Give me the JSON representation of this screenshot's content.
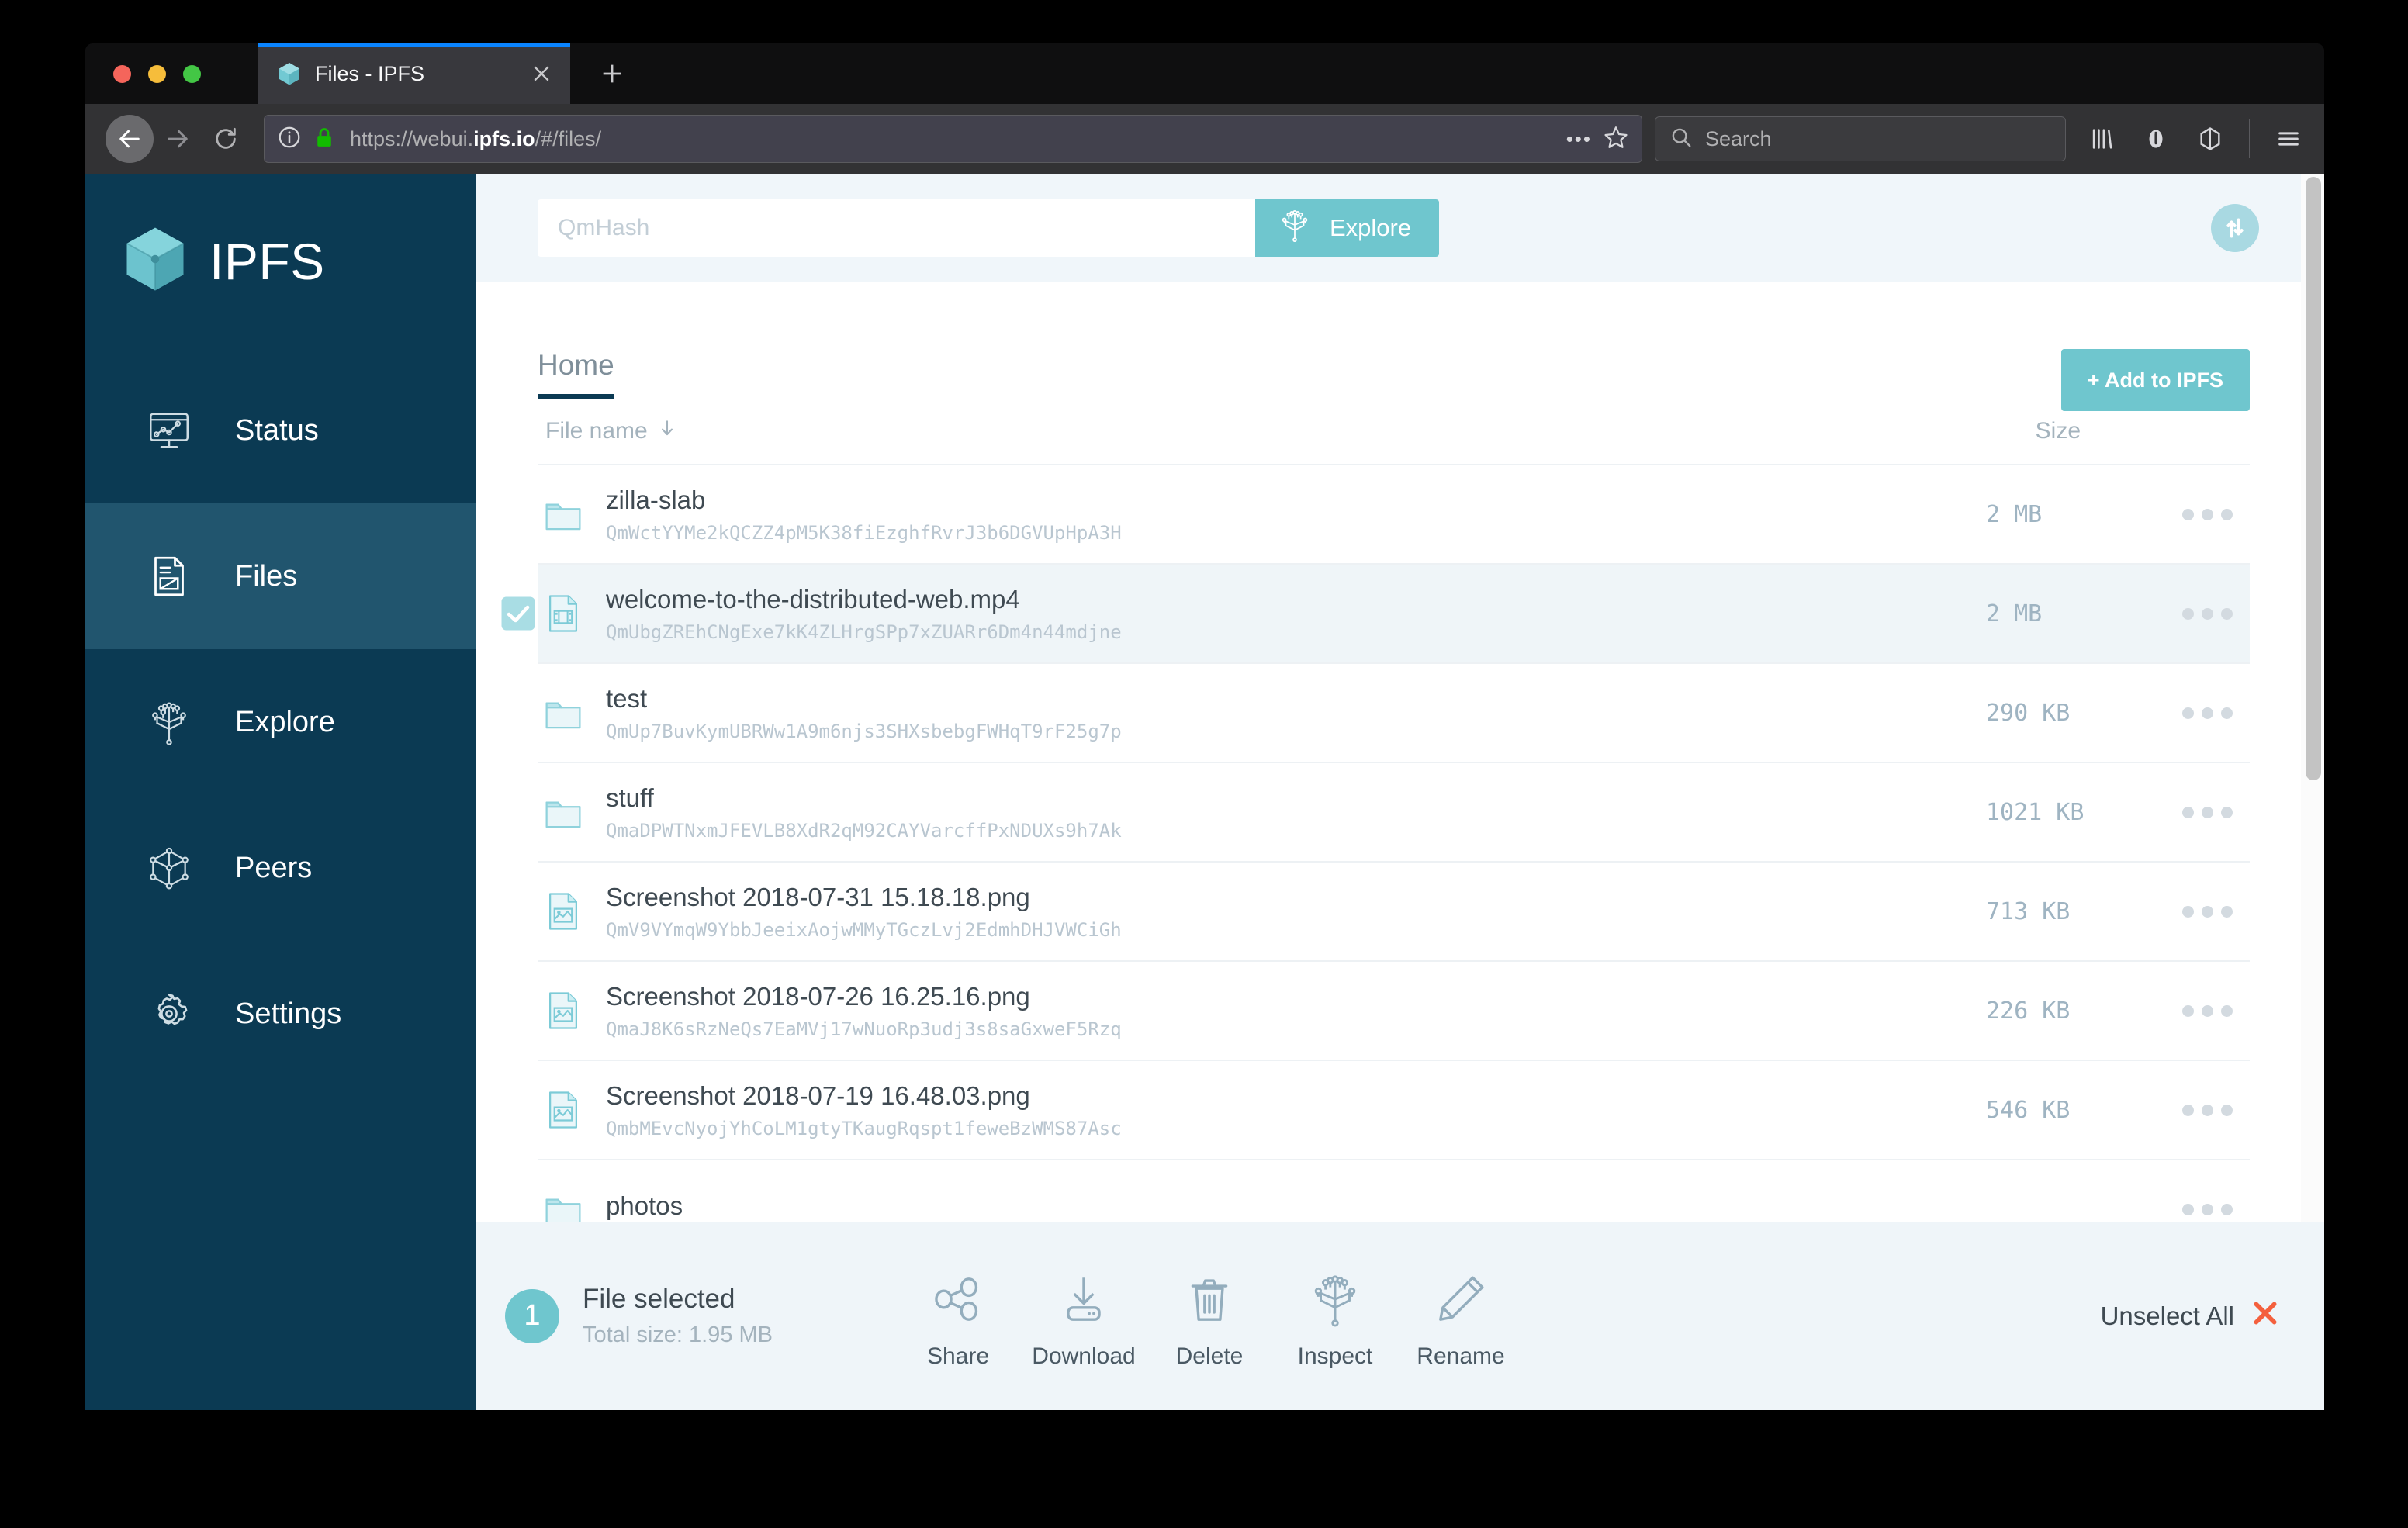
{
  "browser": {
    "tab": {
      "title": "Files - IPFS",
      "favicon_icon": "ipfs-cube-icon",
      "close_icon": "close-icon"
    },
    "new_tab_label": "+",
    "nav": {
      "back_icon": "back-arrow-icon",
      "forward_icon": "forward-arrow-icon",
      "reload_icon": "reload-icon"
    },
    "url": {
      "info_icon": "page-info-icon",
      "lock_icon": "lock-icon",
      "prefix": "https://webui.",
      "host": "ipfs.io",
      "path": "/#/files/",
      "more_icon": "more-actions-icon",
      "bookmark_icon": "star-icon"
    },
    "search": {
      "placeholder": "Search",
      "icon": "search-icon"
    },
    "toolbar_icons": [
      "library-icon",
      "sync-account-icon",
      "ipfs-companion-icon",
      "hamburger-menu-icon"
    ]
  },
  "sidebar": {
    "brand": "IPFS",
    "logo_icon": "ipfs-cube-logo-icon",
    "items": [
      {
        "label": "Status",
        "icon": "status-monitor-icon",
        "active": false
      },
      {
        "label": "Files",
        "icon": "file-document-icon",
        "active": true
      },
      {
        "label": "Explore",
        "icon": "explore-tree-icon",
        "active": false
      },
      {
        "label": "Peers",
        "icon": "peers-cube-icon",
        "active": false
      },
      {
        "label": "Settings",
        "icon": "settings-gear-icon",
        "active": false
      }
    ]
  },
  "app_header": {
    "hash_input_placeholder": "QmHash",
    "hash_input_value": "",
    "explore_button": "Explore",
    "explore_icon": "explore-tree-icon",
    "sync_icon": "sync-up-down-icon"
  },
  "files_page": {
    "tab_label": "Home",
    "add_button": "+ Add to IPFS",
    "columns": {
      "name": "File name",
      "name_sort_icon": "arrow-down-icon",
      "size": "Size"
    },
    "rows": [
      {
        "name": "zilla-slab",
        "hash": "QmWctYYMe2kQCZZ4pM5K38fiEzghfRvrJ3b6DGVUpHpA3H",
        "size": "2 MB",
        "type": "folder",
        "selected": false
      },
      {
        "name": "welcome-to-the-distributed-web.mp4",
        "hash": "QmUbgZREhCNgExe7kK4ZLHrgSPp7xZUARr6Dm4n44mdjne",
        "size": "2 MB",
        "type": "video",
        "selected": true
      },
      {
        "name": "test",
        "hash": "QmUp7BuvKymUBRWw1A9m6njs3SHXsbebgFWHqT9rF25g7p",
        "size": "290 KB",
        "type": "folder",
        "selected": false
      },
      {
        "name": "stuff",
        "hash": "QmaDPWTNxmJFEVLB8XdR2qM92CAYVarcffPxNDUXs9h7Ak",
        "size": "1021 KB",
        "type": "folder",
        "selected": false
      },
      {
        "name": "Screenshot 2018-07-31 15.18.18.png",
        "hash": "QmV9VYmqW9YbbJeeixAojwMMyTGczLvj2EdmhDHJVWCiGh",
        "size": "713 KB",
        "type": "image",
        "selected": false
      },
      {
        "name": "Screenshot 2018-07-26 16.25.16.png",
        "hash": "QmaJ8K6sRzNeQs7EaMVj17wNuoRp3udj3s8saGxweF5Rzq",
        "size": "226 KB",
        "type": "image",
        "selected": false
      },
      {
        "name": "Screenshot 2018-07-19 16.48.03.png",
        "hash": "QmbMEvcNyojYhCoLM1gtyTKaugRqspt1feweBzWMS87Asc",
        "size": "546 KB",
        "type": "image",
        "selected": false
      },
      {
        "name": "photos",
        "hash": "",
        "size": "",
        "type": "folder",
        "selected": false
      }
    ],
    "row_menu_icon": "more-options-icon"
  },
  "selection_bar": {
    "count": "1",
    "title": "File selected",
    "subtitle": "Total size: 1.95 MB",
    "actions": [
      {
        "label": "Share",
        "icon": "share-icon"
      },
      {
        "label": "Download",
        "icon": "download-icon"
      },
      {
        "label": "Delete",
        "icon": "trash-icon"
      },
      {
        "label": "Inspect",
        "icon": "explore-tree-icon"
      },
      {
        "label": "Rename",
        "icon": "pencil-icon"
      }
    ],
    "unselect_label": "Unselect All",
    "unselect_icon": "close-x-icon"
  },
  "colors": {
    "sidebar_bg": "#0b3a53",
    "sidebar_active": "#21556e",
    "accent_teal": "#6fc6ce",
    "header_bg": "#f0f6fa",
    "danger_red": "#f4603e"
  }
}
